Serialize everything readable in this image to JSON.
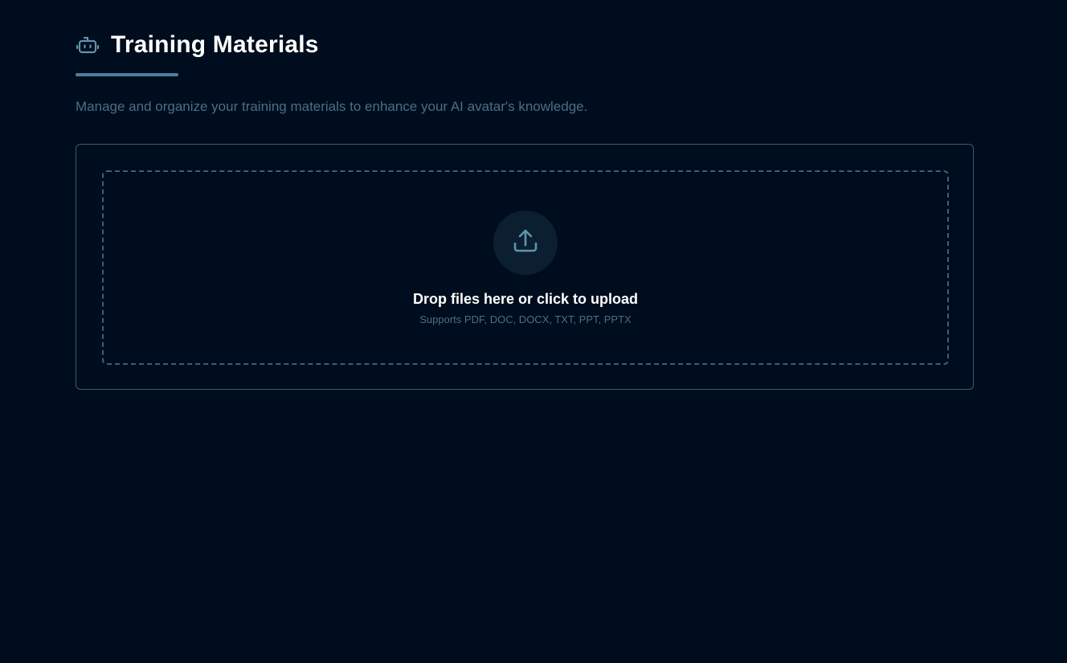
{
  "header": {
    "title": "Training Materials",
    "icon": "bot-icon"
  },
  "subtitle": "Manage and organize your training materials to enhance your AI avatar's knowledge.",
  "upload": {
    "icon": "upload-icon",
    "title": "Drop files here or click to upload",
    "hint": "Supports PDF, DOC, DOCX, TXT, PPT, PPTX"
  },
  "colors": {
    "background": "#000d1e",
    "accent": "#4d7f9a",
    "muted_text": "#4a6e86",
    "border": "#3b5a70"
  }
}
